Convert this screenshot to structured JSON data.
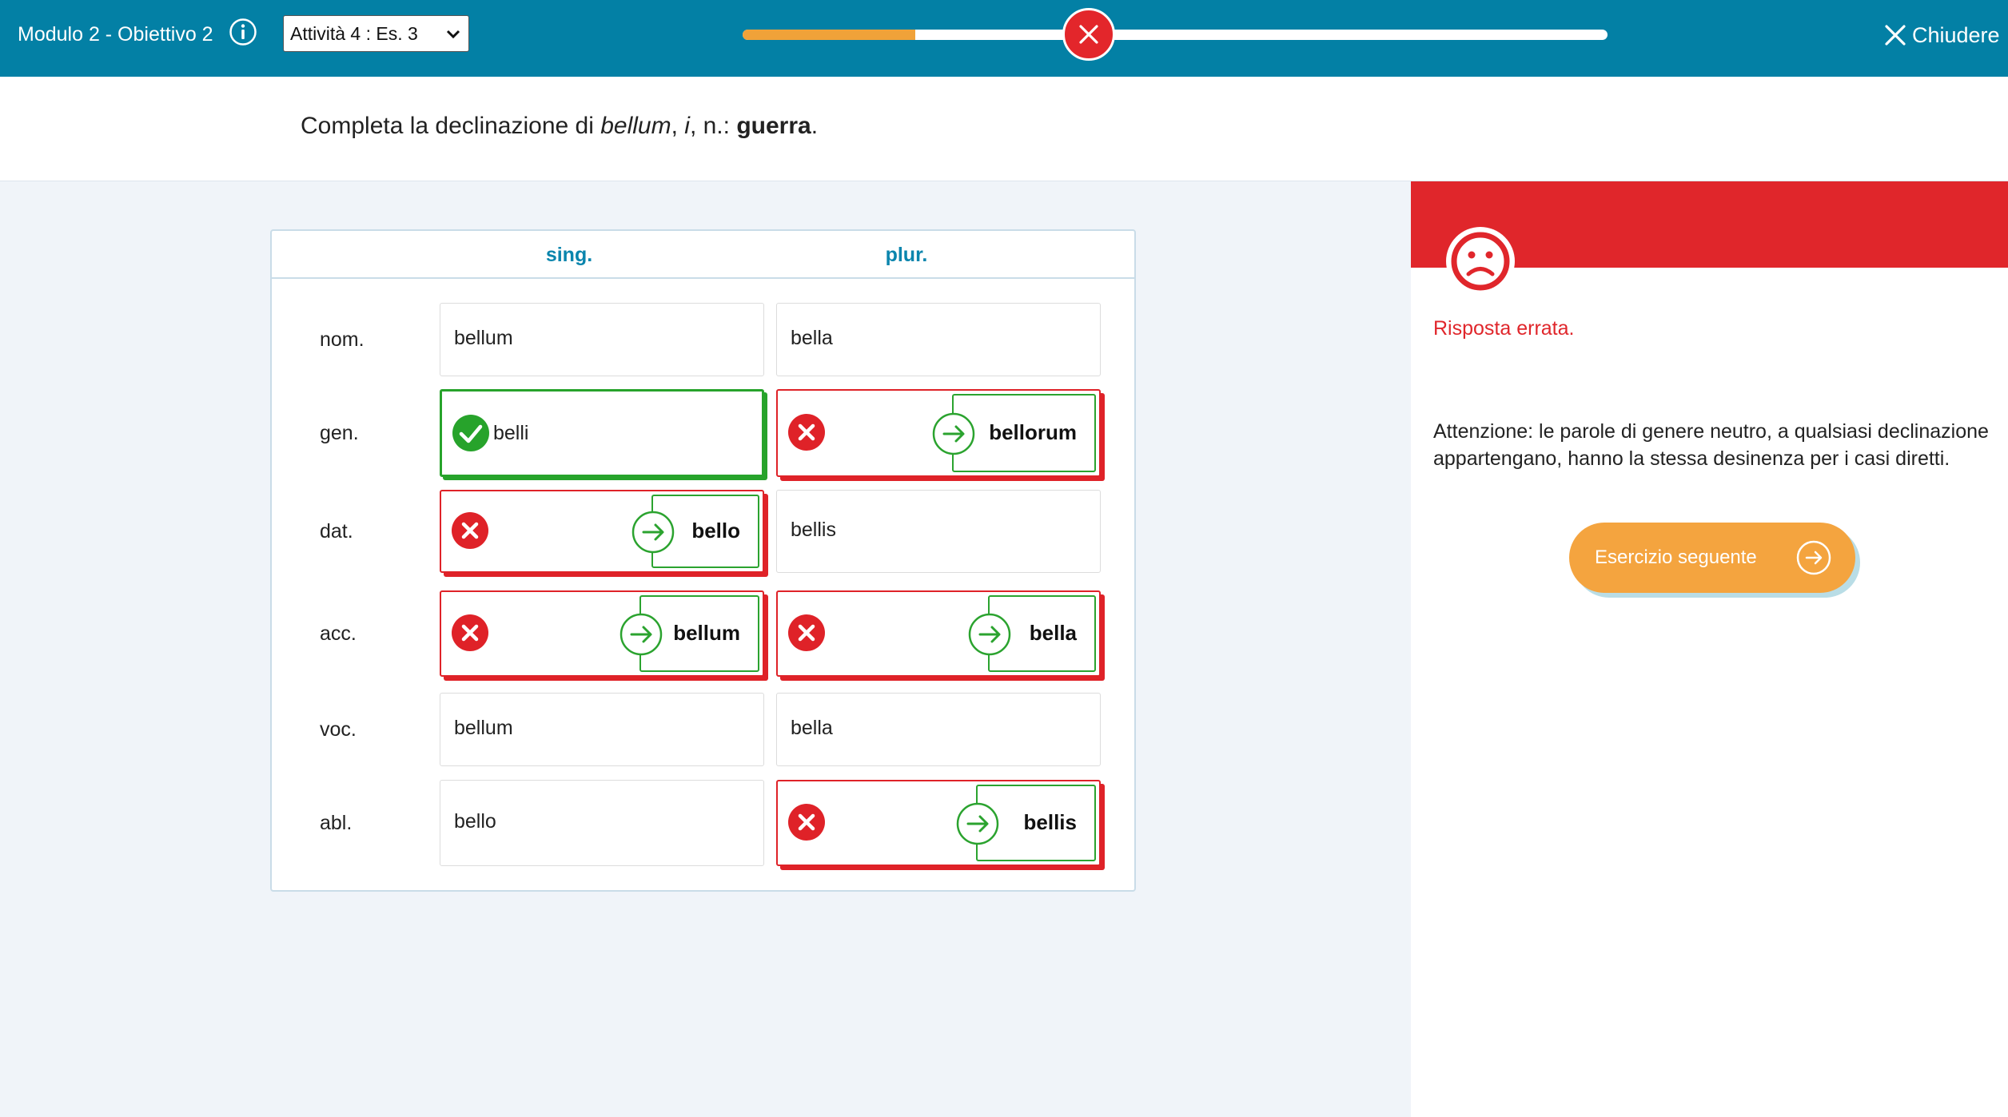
{
  "header": {
    "title": "Modulo 2 - Obiettivo 2",
    "activity_select": {
      "selected": "Attività 4 : Es. 3"
    },
    "progress": {
      "fraction_complete": 0.2,
      "marker_status": "wrong"
    },
    "close_label": "Chiudere"
  },
  "prompt": {
    "lead": "Completa la declinazione di ",
    "word": "bellum",
    "sep1": ", ",
    "genitive": "i",
    "sep2": ", n.: ",
    "meaning": "guerra",
    "end": "."
  },
  "table": {
    "columns": [
      "sing.",
      "plur."
    ],
    "rows": [
      {
        "case": "nom.",
        "sing": {
          "status": "neutral",
          "value": "bellum"
        },
        "plur": {
          "status": "neutral",
          "value": "bella"
        }
      },
      {
        "case": "gen.",
        "sing": {
          "status": "correct",
          "value": "belli"
        },
        "plur": {
          "status": "wrong",
          "value": "",
          "answer": "bellorum"
        }
      },
      {
        "case": "dat.",
        "sing": {
          "status": "wrong",
          "value": "",
          "answer": "bello"
        },
        "plur": {
          "status": "neutral",
          "value": "bellis"
        }
      },
      {
        "case": "acc.",
        "sing": {
          "status": "wrong",
          "value": "",
          "answer": "bellum"
        },
        "plur": {
          "status": "wrong",
          "value": "",
          "answer": "bella"
        }
      },
      {
        "case": "voc.",
        "sing": {
          "status": "neutral",
          "value": "bellum"
        },
        "plur": {
          "status": "neutral",
          "value": "bella"
        }
      },
      {
        "case": "abl.",
        "sing": {
          "status": "neutral",
          "value": "bello"
        },
        "plur": {
          "status": "wrong",
          "value": "",
          "answer": "bellis"
        }
      }
    ]
  },
  "feedback": {
    "icon": "sad-face-icon",
    "title": "Risposta errata.",
    "text": "Attenzione: le parole di genere neutro, a qualsiasi declinazione appartengano, hanno la stessa desinenza per i casi diretti.",
    "next_button_label": "Esercizio seguente"
  },
  "colors": {
    "header_bg": "#0380a5",
    "progress_fill": "#f0a239",
    "error_red": "#e0262b",
    "success_green": "#27a32b",
    "column_header": "#0a85ad",
    "button_orange": "#f4a43f"
  }
}
